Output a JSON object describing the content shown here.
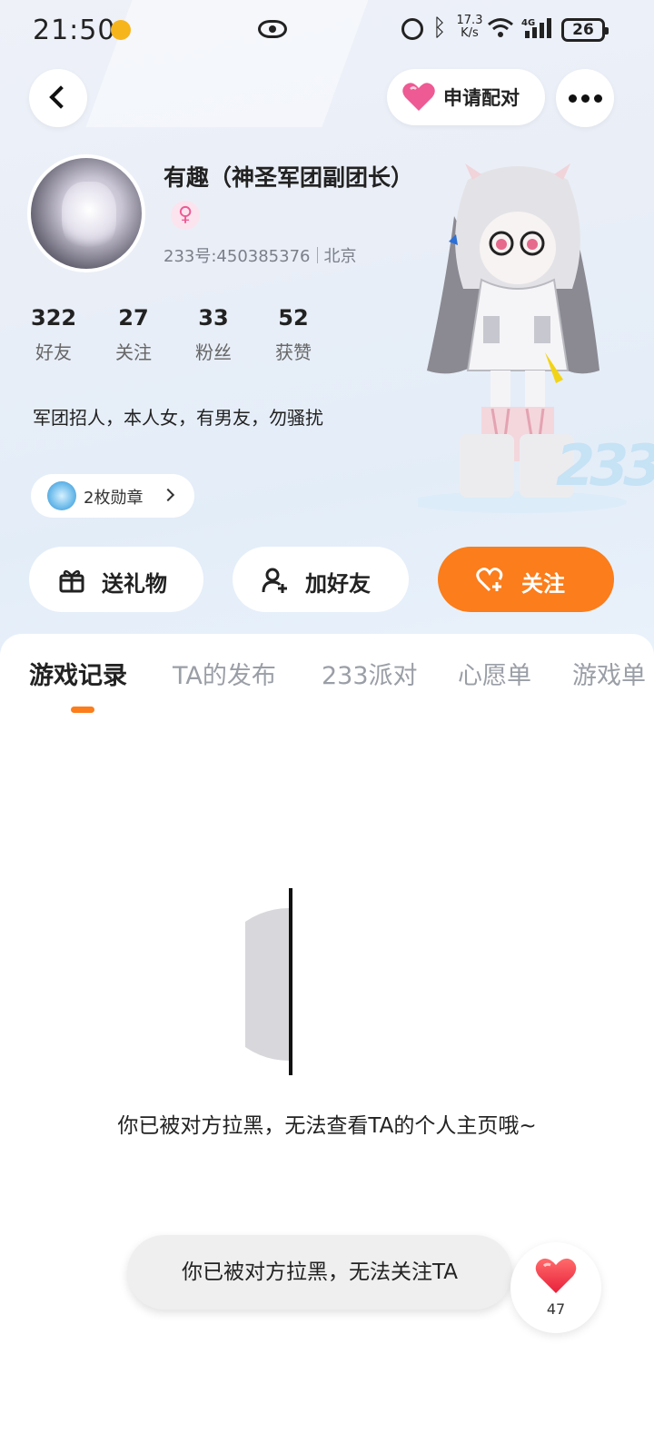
{
  "status_bar": {
    "time": "21:50",
    "net_speed_value": "17.3",
    "net_speed_unit": "K/s",
    "network_type": "4G",
    "battery": "26"
  },
  "header": {
    "pair_label": "申请配对"
  },
  "profile": {
    "nickname": "有趣（神圣军团副团长）",
    "gender_symbol": "♀",
    "id_text": "233号:450385376",
    "location": "北京",
    "stats": [
      {
        "value": "322",
        "label": "好友"
      },
      {
        "value": "27",
        "label": "关注"
      },
      {
        "value": "33",
        "label": "粉丝"
      },
      {
        "value": "52",
        "label": "获赞"
      }
    ],
    "bio": "军团招人，本人女，有男友，勿骚扰",
    "medals_label": "2枚勋章"
  },
  "decor": {
    "platform_text": "233"
  },
  "actions": {
    "gift_label": "送礼物",
    "add_friend_label": "加好友",
    "follow_label": "关注"
  },
  "tabs": [
    "游戏记录",
    "TA的发布",
    "233派对",
    "心愿单",
    "游戏单"
  ],
  "active_tab": "游戏记录",
  "empty_state": {
    "message": "你已被对方拉黑，无法查看TA的个人主页哦~"
  },
  "toast": {
    "message": "你已被对方拉黑，无法关注TA"
  },
  "like": {
    "count": "47"
  },
  "colors": {
    "accent_orange": "#fb7d1b",
    "heart_pink": "#ee5a93",
    "heart_red": "#f0334a"
  }
}
